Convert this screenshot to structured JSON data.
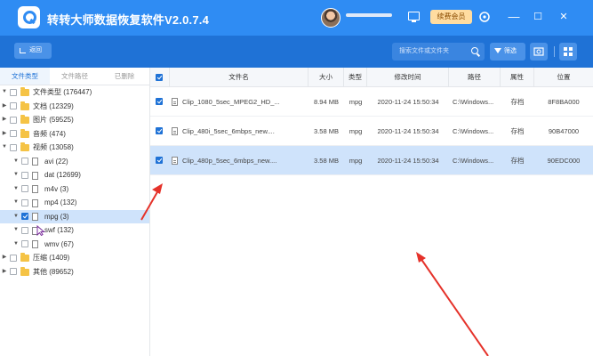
{
  "app": {
    "title": "转转大师数据恢复软件V2.0.7.4",
    "user_name": "",
    "vip_label": "续费会员",
    "window_controls": {
      "minimize": "—",
      "maximize": "☐",
      "close": "✕"
    }
  },
  "toolbar": {
    "back_label": "返回",
    "search_placeholder": "搜索文件或文件夹",
    "filter_label": "筛选"
  },
  "left_tabs": [
    {
      "label": "文件类型",
      "active": true
    },
    {
      "label": "文件路径",
      "active": false
    },
    {
      "label": "已删除",
      "active": false
    }
  ],
  "tree": [
    {
      "label": "文件类型 (176447)",
      "checked": false,
      "icon": "folder",
      "expanded": true,
      "selected": false
    },
    {
      "label": "文档 (12329)",
      "checked": false,
      "icon": "folder",
      "expanded": false,
      "selected": false
    },
    {
      "label": "图片 (59525)",
      "checked": false,
      "icon": "folder",
      "expanded": false,
      "selected": false
    },
    {
      "label": "音频 (474)",
      "checked": false,
      "icon": "folder",
      "expanded": false,
      "selected": false
    },
    {
      "label": "视频 (13058)",
      "checked": false,
      "icon": "folder",
      "expanded": true,
      "selected": false
    },
    {
      "label": "avi (22)",
      "checked": false,
      "icon": "file",
      "expanded": true,
      "selected": false
    },
    {
      "label": "dat (12699)",
      "checked": false,
      "icon": "file",
      "expanded": true,
      "selected": false
    },
    {
      "label": "m4v (3)",
      "checked": false,
      "icon": "file",
      "expanded": true,
      "selected": false
    },
    {
      "label": "mp4 (132)",
      "checked": false,
      "icon": "file",
      "expanded": true,
      "selected": false
    },
    {
      "label": "mpg (3)",
      "checked": true,
      "icon": "file",
      "expanded": true,
      "selected": true
    },
    {
      "label": "swf (132)",
      "checked": false,
      "icon": "file",
      "expanded": true,
      "selected": false
    },
    {
      "label": "wmv (67)",
      "checked": false,
      "icon": "file",
      "expanded": true,
      "selected": false
    },
    {
      "label": "压缩 (1409)",
      "checked": false,
      "icon": "folder",
      "expanded": false,
      "selected": false
    },
    {
      "label": "其他 (89652)",
      "checked": false,
      "icon": "folder",
      "expanded": false,
      "selected": false
    }
  ],
  "table": {
    "all_checked": true,
    "columns": [
      "文件名",
      "大小",
      "类型",
      "修改时间",
      "路径",
      "属性",
      "位置"
    ],
    "rows": [
      {
        "checked": true,
        "selected": false,
        "name": "Clip_1080_5sec_MPEG2_HD_...",
        "size": "8.94 MB",
        "type": "mpg",
        "modified": "2020-11-24 15:50:34",
        "path": "C:\\Windows...",
        "attr": "存档",
        "location": "8F8BA000"
      },
      {
        "checked": true,
        "selected": false,
        "name": "Clip_480i_5sec_6mbps_new....",
        "size": "3.58 MB",
        "type": "mpg",
        "modified": "2020-11-24 15:50:34",
        "path": "C:\\Windows...",
        "attr": "存档",
        "location": "90B47000"
      },
      {
        "checked": true,
        "selected": true,
        "name": "Clip_480p_5sec_6mbps_new....",
        "size": "3.58 MB",
        "type": "mpg",
        "modified": "2020-11-24 15:50:34",
        "path": "C:\\Windows...",
        "attr": "存档",
        "location": "90EDC000"
      }
    ]
  },
  "colors": {
    "titlebar": "#2f8cf3",
    "toolbar": "#1f72d6",
    "selection": "#cfe3fb",
    "annotation_arrow": "#e5322a"
  }
}
